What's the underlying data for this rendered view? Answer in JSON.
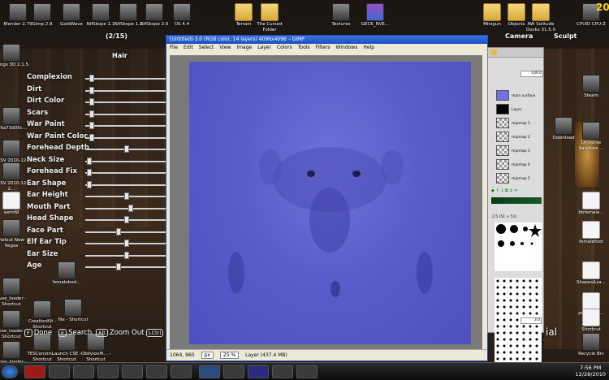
{
  "desktop_icons_top": [
    {
      "label": "Blender 2.79",
      "kind": "app"
    },
    {
      "label": "Gimp 2.8",
      "kind": "app"
    },
    {
      "label": "GoldWave",
      "kind": "app"
    },
    {
      "label": "NifSkope 1.1",
      "kind": "app"
    },
    {
      "label": "NifSkope 1.2",
      "kind": "app"
    },
    {
      "label": "NifSkope 2.0",
      "kind": "app"
    },
    {
      "label": "OS 4.4",
      "kind": "app"
    },
    {
      "label": "Terrain",
      "kind": "folder"
    },
    {
      "label": "The Cursed Folder",
      "kind": "folder"
    },
    {
      "label": "Textures",
      "kind": "app"
    },
    {
      "label": "GECK_NVE...",
      "kind": "winrar"
    },
    {
      "label": "Minigun",
      "kind": "folder"
    },
    {
      "label": "Objects",
      "kind": "folder"
    },
    {
      "label": "AW Solitude Docks 31.5.0",
      "kind": "folder"
    },
    {
      "label": "CPUID CPU-Z",
      "kind": "app"
    }
  ],
  "desktop_icons_left": [
    {
      "label": "Wings 3D 2.1.5",
      "kind": "app"
    },
    {
      "label": "f06a73d05c...",
      "kind": "app"
    },
    {
      "label": "TESV 2010-12-2...",
      "kind": "app"
    },
    {
      "label": "TESV 2010-12-2...",
      "kind": "app"
    },
    {
      "label": "awmNI",
      "kind": "doc"
    },
    {
      "label": "Fallout New Vegas",
      "kind": "app"
    },
    {
      "label": "nvse_loader - Shortcut",
      "kind": "app"
    },
    {
      "label": "skse_loader - Shortcut",
      "kind": "app"
    },
    {
      "label": "obse_loader - Shortcut",
      "kind": "app"
    }
  ],
  "desktop_icons_right": [
    {
      "label": "Steam",
      "kind": "app"
    },
    {
      "label": "Download",
      "kind": "app"
    },
    {
      "label": "Universe Sandbox ...",
      "kind": "app"
    },
    {
      "label": "bbfemale...",
      "kind": "doc"
    },
    {
      "label": "femalefoot",
      "kind": "doc"
    },
    {
      "label": "Shapes&sa...",
      "kind": "doc"
    },
    {
      "label": "pointlight...",
      "kind": "doc"
    },
    {
      "label": "Shortcut",
      "kind": "doc"
    },
    {
      "label": "Recycle Bin",
      "kind": "app"
    }
  ],
  "desktop_icons_bottom": [
    {
      "label": "CreationKit - Shortcut"
    },
    {
      "label": "TESConstru... Shortcut"
    },
    {
      "label": "Launch CSE - Shortcut"
    },
    {
      "label": "OblivionM... - Shortcut"
    },
    {
      "label": "femalebod..."
    },
    {
      "label": "file - Shortcut"
    }
  ],
  "game_overlay": {
    "counter": "(2/15)",
    "tabs": [
      "Hair",
      "Camera",
      "Sculpt"
    ],
    "sliders": [
      {
        "label": "Complexion",
        "value": 0.05
      },
      {
        "label": "Dirt",
        "value": 0.05
      },
      {
        "label": "Dirt Color",
        "value": 0.05
      },
      {
        "label": "Scars",
        "value": 0.05
      },
      {
        "label": "War Paint",
        "value": 0.05
      },
      {
        "label": "War Paint Color",
        "value": 0.05
      },
      {
        "label": "Forehead Depth",
        "value": 0.5
      },
      {
        "label": "Neck Size",
        "value": 0.02
      },
      {
        "label": "Forehead Fix",
        "value": 0.02
      },
      {
        "label": "Ear Shape",
        "value": 0.02
      },
      {
        "label": "Ear Height",
        "value": 0.5
      },
      {
        "label": "Mouth Part",
        "value": 0.55
      },
      {
        "label": "Head Shape",
        "value": 0.5
      },
      {
        "label": "Face Part",
        "value": 0.4
      },
      {
        "label": "Elf Ear Tip",
        "value": 0.5
      },
      {
        "label": "Ear Size",
        "value": 0.5
      },
      {
        "label": "Age",
        "value": 0.4
      }
    ],
    "hints": [
      {
        "key": "F",
        "label": "Done"
      },
      {
        "key": "E",
        "label": "Search"
      },
      {
        "key": "Alt",
        "label": "Zoom Out"
      },
      {
        "key": "LCtrl",
        "label": "L"
      }
    ],
    "right_hint": "ial"
  },
  "gimp": {
    "title": "[Untitled]-3.0 (RGB color, 14 layers) 4096x4096 – GIMP",
    "menus": [
      "File",
      "Edit",
      "Select",
      "View",
      "Image",
      "Layer",
      "Colors",
      "Tools",
      "Filters",
      "Windows",
      "Help"
    ],
    "status_coords": "1064, 960",
    "status_unit": "px",
    "status_zoom": "25 %",
    "status_layer": "Layer (437.4 MB)"
  },
  "dock": {
    "opacity": "100.0",
    "layers": [
      "main surface",
      "Layer",
      "mipmap 1",
      "mipmap 2",
      "mipmap 3",
      "mipmap 4",
      "mipmap 5"
    ],
    "brush_info": "2.5 (51 × 51)",
    "spacing": "3.0"
  },
  "taskbar": {
    "time": "7:56 PM",
    "date": "12/28/2010"
  },
  "fps": "20",
  "colors": {
    "canvas": "#5a5ccc",
    "titlebar": "#2a5fd0",
    "overlay_text": "#eeeeee"
  }
}
